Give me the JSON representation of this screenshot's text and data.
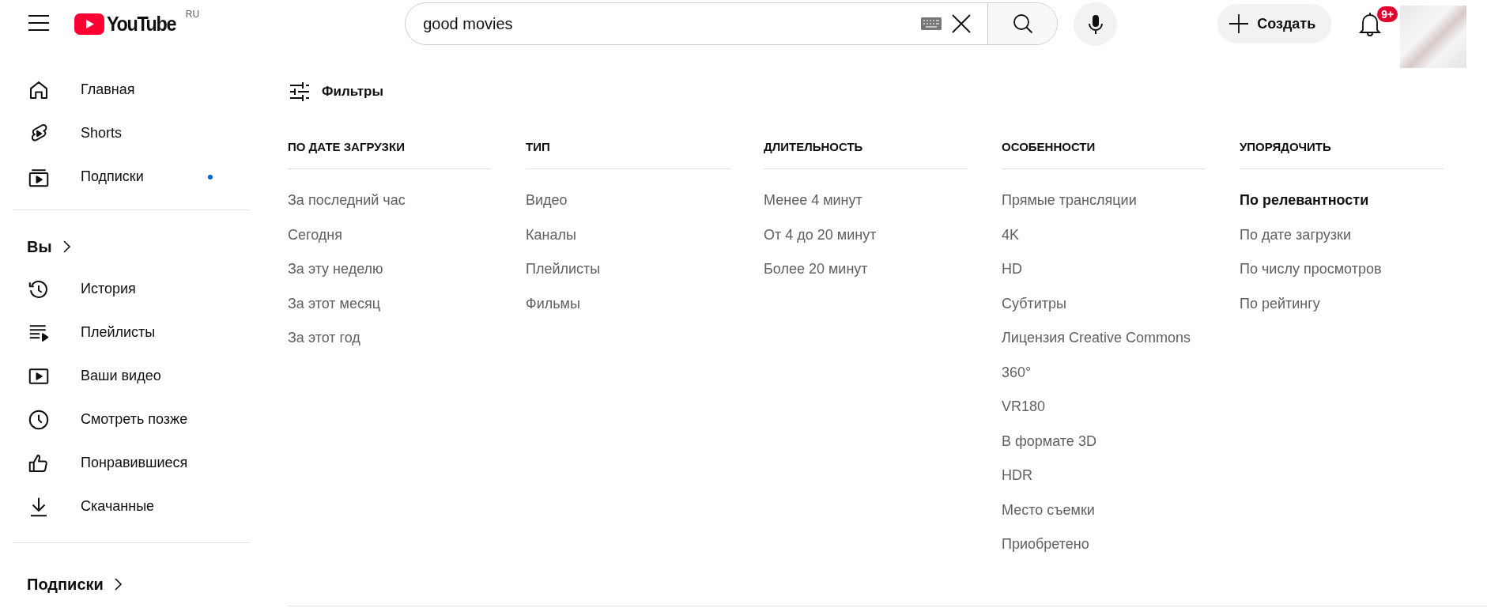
{
  "header": {
    "logo_text": "YouTube",
    "region": "RU",
    "search": {
      "value": "good movies"
    },
    "create_button": "Создать",
    "notifications_badge": "9+"
  },
  "sidebar": {
    "sections": [
      {
        "items": [
          {
            "label": "Главная",
            "new_content": false
          },
          {
            "label": "Shorts",
            "new_content": false
          },
          {
            "label": "Подписки",
            "new_content": true
          }
        ]
      },
      {
        "title": "Вы",
        "items": [
          {
            "label": "История",
            "new_content": false
          },
          {
            "label": "Плейлисты",
            "new_content": false
          },
          {
            "label": "Ваши видео",
            "new_content": false
          },
          {
            "label": "Смотреть позже",
            "new_content": false
          },
          {
            "label": "Понравившиеся",
            "new_content": false
          },
          {
            "label": "Скачанные",
            "new_content": false
          }
        ]
      },
      {
        "title": "Подписки"
      }
    ]
  },
  "filters": {
    "title": "Фильтры",
    "groups": [
      {
        "heading": "ПО ДАТЕ ЗАГРУЗКИ",
        "options": [
          {
            "label": "За последний час",
            "selected": false
          },
          {
            "label": "Сегодня",
            "selected": false
          },
          {
            "label": "За эту неделю",
            "selected": false
          },
          {
            "label": "За этот месяц",
            "selected": false
          },
          {
            "label": "За этот год",
            "selected": false
          }
        ]
      },
      {
        "heading": "ТИП",
        "options": [
          {
            "label": "Видео",
            "selected": false
          },
          {
            "label": "Каналы",
            "selected": false
          },
          {
            "label": "Плейлисты",
            "selected": false
          },
          {
            "label": "Фильмы",
            "selected": false
          }
        ]
      },
      {
        "heading": "ДЛИТЕЛЬНОСТЬ",
        "options": [
          {
            "label": "Менее 4 минут",
            "selected": false
          },
          {
            "label": "От 4 до 20 минут",
            "selected": false
          },
          {
            "label": "Более 20 минут",
            "selected": false
          }
        ]
      },
      {
        "heading": "ОСОБЕННОСТИ",
        "options": [
          {
            "label": "Прямые трансляции",
            "selected": false
          },
          {
            "label": "4K",
            "selected": false
          },
          {
            "label": "HD",
            "selected": false
          },
          {
            "label": "Субтитры",
            "selected": false
          },
          {
            "label": "Лицензия Creative Commons",
            "selected": false
          },
          {
            "label": "360°",
            "selected": false
          },
          {
            "label": "VR180",
            "selected": false
          },
          {
            "label": "В формате 3D",
            "selected": false
          },
          {
            "label": "HDR",
            "selected": false
          },
          {
            "label": "Место съемки",
            "selected": false
          },
          {
            "label": "Приобретено",
            "selected": false
          }
        ]
      },
      {
        "heading": "УПОРЯДОЧИТЬ",
        "options": [
          {
            "label": "По релевантности",
            "selected": true
          },
          {
            "label": "По дате загрузки",
            "selected": false
          },
          {
            "label": "По числу просмотров",
            "selected": false
          },
          {
            "label": "По рейтингу",
            "selected": false
          }
        ]
      }
    ]
  }
}
